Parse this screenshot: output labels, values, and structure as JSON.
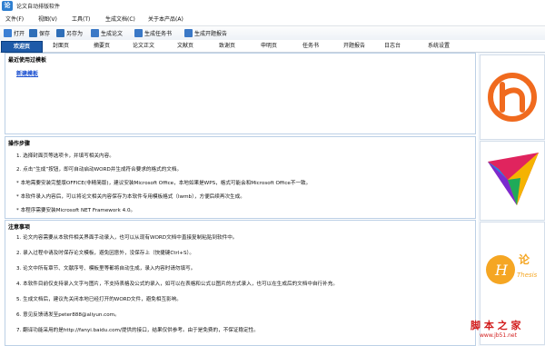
{
  "window": {
    "title": "论文自动排版软件",
    "app_icon_glyph": "论"
  },
  "menu": [
    "文件(F)",
    "视图(V)",
    "工具(T)",
    "生成文档(C)",
    "关于本产品(A)"
  ],
  "toolbar": [
    {
      "label": "打开",
      "icon": "open-icon",
      "color": "#3b7fd4"
    },
    {
      "label": "保存",
      "icon": "save-icon",
      "color": "#2f6fb8"
    },
    {
      "label": "另存为",
      "icon": "save-as-icon",
      "color": "#2f6fb8"
    },
    {
      "label": "生成论文",
      "icon": "generate-paper-icon",
      "color": "#3a78c6"
    },
    {
      "label": "生成任务书",
      "icon": "generate-task-icon",
      "color": "#3a78c6"
    },
    {
      "label": "生成开题报告",
      "icon": "generate-proposal-icon",
      "color": "#3a78c6"
    }
  ],
  "tabs": [
    "欢迎页",
    "封面页",
    "摘要页",
    "论文正文",
    "文献页",
    "致谢页",
    "申明页",
    "任务书",
    "开题报告",
    "日志台",
    "系统设置"
  ],
  "active_tab": "欢迎页",
  "recent": {
    "title": "最近使用过模板",
    "link": "新建模板"
  },
  "steps": {
    "title": "操作步骤",
    "items": [
      "1. 选择封面页等选项卡，并填写相关内容。",
      "2. 点击“生成”按钮，即可自动启动WORD并生成符合要求的格式的文档。",
      "* 本地需要安装完整版OFFICE(非精简版)，建议安装Microsoft Office，本地如果是WPS，格式可能会和Microsoft Office不一致。",
      "* 本软件录入内容后，可以将论文相关内容保存为本软件专用模板格式（lwmb），方便后续再次生成。",
      "* 本程序需要安装Microsoft NET Framework 4.0。"
    ]
  },
  "notes": {
    "title": "注意事项",
    "items": [
      "1. 论文内容需要从本软件相关界面手动录入，也可以从现有WORD文档中直接复制粘贴到软件中。",
      "2. 录入过程中请及时保存论文模板，避免因意外，没保存上（快捷键Ctrl+S）。",
      "3. 论文中所有章节、文献序号、模板里等都将自动生成，录入内容时请勿填写。",
      "4. 本软件目前仅支持录入文字与图片，不支持表格及公式的录入，如可以在表格和公式以图片的方式录入，也可以在生成后的文档中自行补充。",
      "5. 生成文档后，建议先关闭本地已经打开的WORD文件，避免相互影响。",
      "6. 意见反馈请发至peter888@aliyun.com。",
      "7. 翻译功能采用的是http://fanyi.baidu.com/提供的接口，结果仅供参考。由于是免费的，不保证稳定性。"
    ]
  },
  "watermark": {
    "text": "脚 本 之 家",
    "url": "www.jb51.net"
  },
  "logo_text": {
    "logo3_a": "论",
    "logo3_b": "Thesis"
  },
  "colors": {
    "accent": "#1e5aa8",
    "logo_orange": "#f06a1e",
    "watermark_red": "#d21c1c"
  }
}
